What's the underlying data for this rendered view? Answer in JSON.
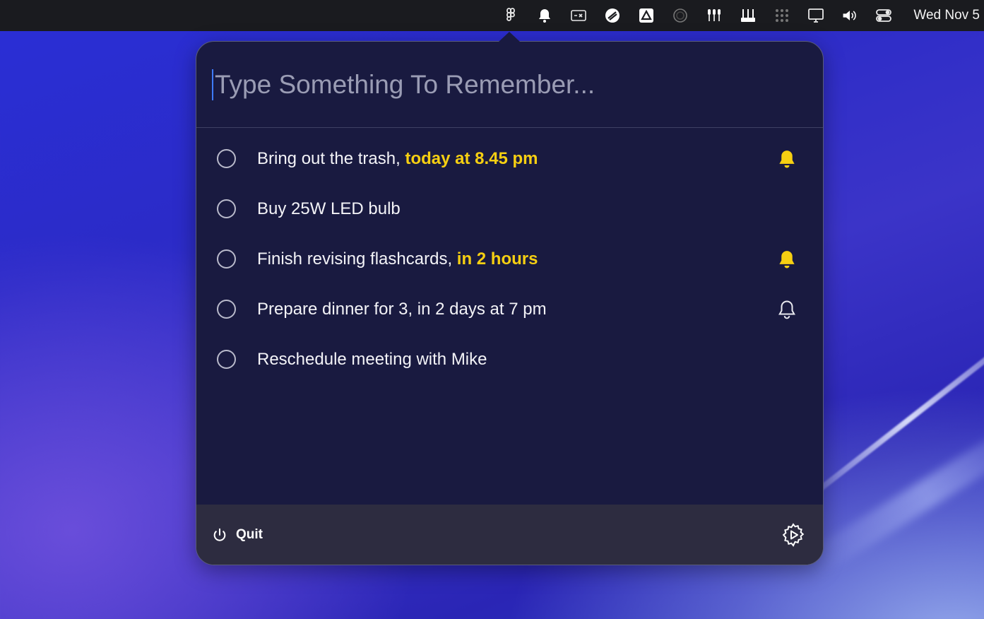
{
  "menubar": {
    "icons": [
      "figma-icon",
      "bell-icon",
      "caption-icon",
      "drafts-icon",
      "drive-icon",
      "circle-icon",
      "mic-array-icon",
      "tools-icon",
      "grid-icon",
      "display-icon",
      "volume-icon",
      "control-center-icon"
    ],
    "clock": "Wed Nov 5"
  },
  "popover": {
    "input": {
      "placeholder": "Type Something To Remember...",
      "value": ""
    },
    "items": [
      {
        "text": "Bring out the trash, ",
        "highlight": "today at 8.45 pm",
        "bell": "filled"
      },
      {
        "text": "Buy 25W LED bulb",
        "highlight": "",
        "bell": "none"
      },
      {
        "text": "Finish revising flashcards, ",
        "highlight": "in 2 hours",
        "bell": "filled"
      },
      {
        "text": "Prepare dinner for 3, in 2 days at 7 pm",
        "highlight": "",
        "bell": "outline"
      },
      {
        "text": "Reschedule meeting with Mike",
        "highlight": "",
        "bell": "none"
      }
    ],
    "footer": {
      "quit_label": "Quit"
    }
  },
  "colors": {
    "highlight": "#f6cf12",
    "popover_bg": "#191a40",
    "footer_bg": "#2d2c40",
    "caret": "#3e7bff"
  }
}
